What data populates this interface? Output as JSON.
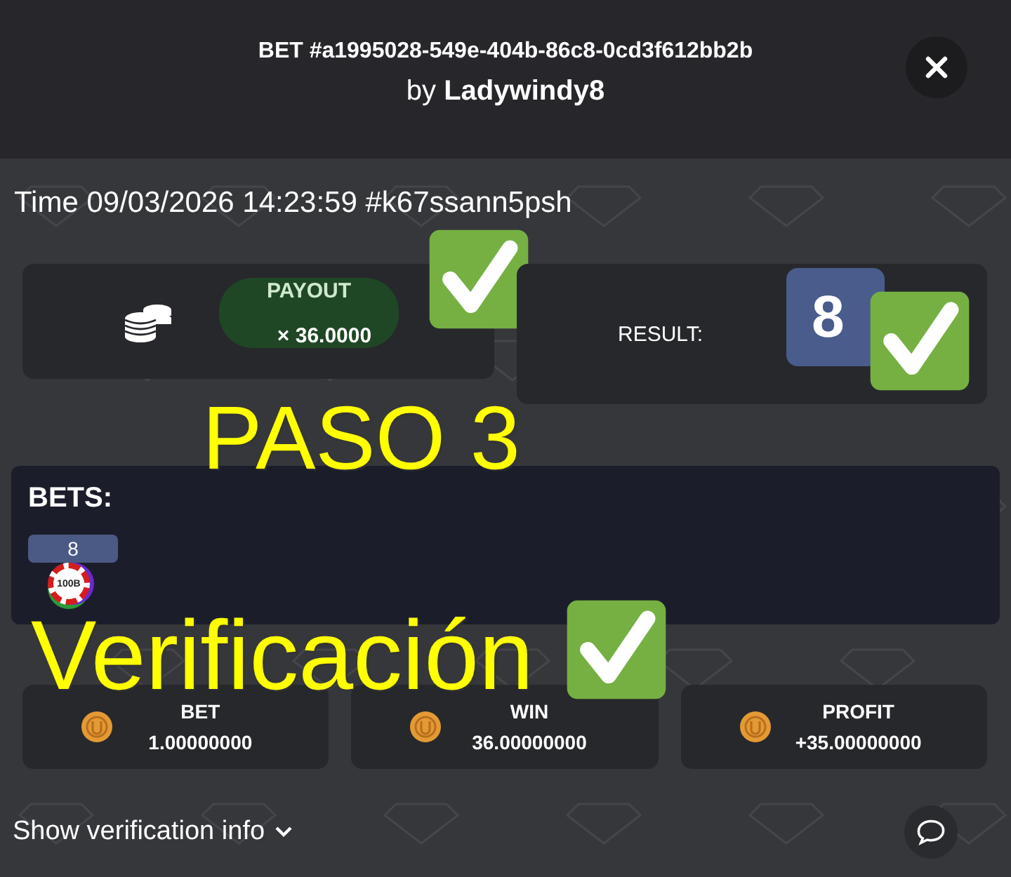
{
  "header": {
    "title": "BET #a1995028-549e-404b-86c8-0cd3f612bb2b",
    "by": "by",
    "user": "Ladywindy8"
  },
  "time": "Time 09/03/2026 14:23:59 #k67ssann5psh",
  "payout": {
    "label": "PAYOUT",
    "value": "× 36.0000",
    "checked": true
  },
  "result": {
    "label": "RESULT:",
    "value": "8",
    "checked": true
  },
  "bets": {
    "title": "BETS:",
    "items": [
      {
        "number": "8",
        "chip": "100B"
      }
    ]
  },
  "stats": [
    {
      "label": "BET",
      "value": "1.00000000"
    },
    {
      "label": "WIN",
      "value": "36.00000000"
    },
    {
      "label": "PROFIT",
      "value": "+35.00000000"
    }
  ],
  "footer": {
    "link": "Show verification info"
  },
  "annotations": [
    {
      "text": "PASO 3",
      "checked": false
    },
    {
      "text": "Verificación",
      "checked": true
    }
  ]
}
